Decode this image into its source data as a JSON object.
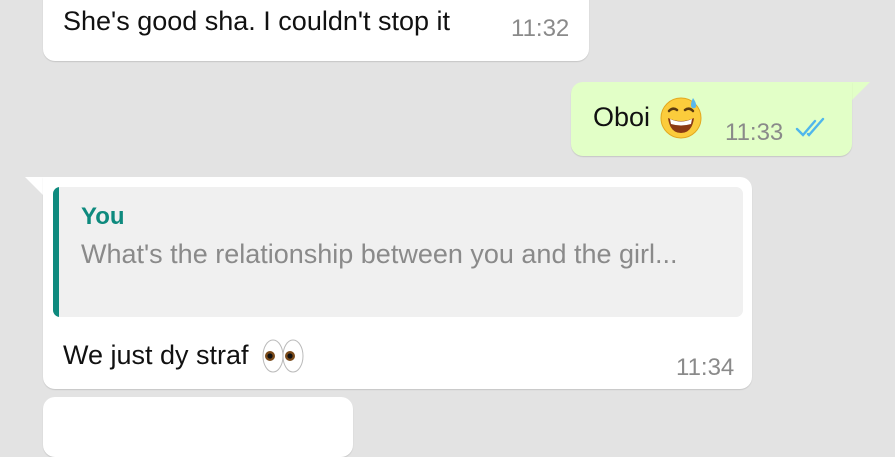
{
  "chat": {
    "messages": [
      {
        "direction": "incoming",
        "text": "She's good sha. I couldn't stop it",
        "time": "11:32"
      },
      {
        "direction": "outgoing",
        "text": "Oboi",
        "emoji": "grinning-sweat-face",
        "time": "11:33",
        "status": "read"
      },
      {
        "direction": "incoming",
        "quote": {
          "author": "You",
          "text": "What's the relationship between you and the girl..."
        },
        "text": "We just dy straf",
        "emoji": "eyes",
        "time": "11:34"
      },
      {
        "direction": "incoming",
        "text": "",
        "time": ""
      }
    ]
  },
  "colors": {
    "background": "#e3e3e3",
    "incoming_bubble": "#ffffff",
    "outgoing_bubble": "#e2ffc7",
    "quote_accent": "#0e8a7e",
    "read_ticks": "#4fb6ec",
    "timestamp": "#8a8a8a"
  }
}
